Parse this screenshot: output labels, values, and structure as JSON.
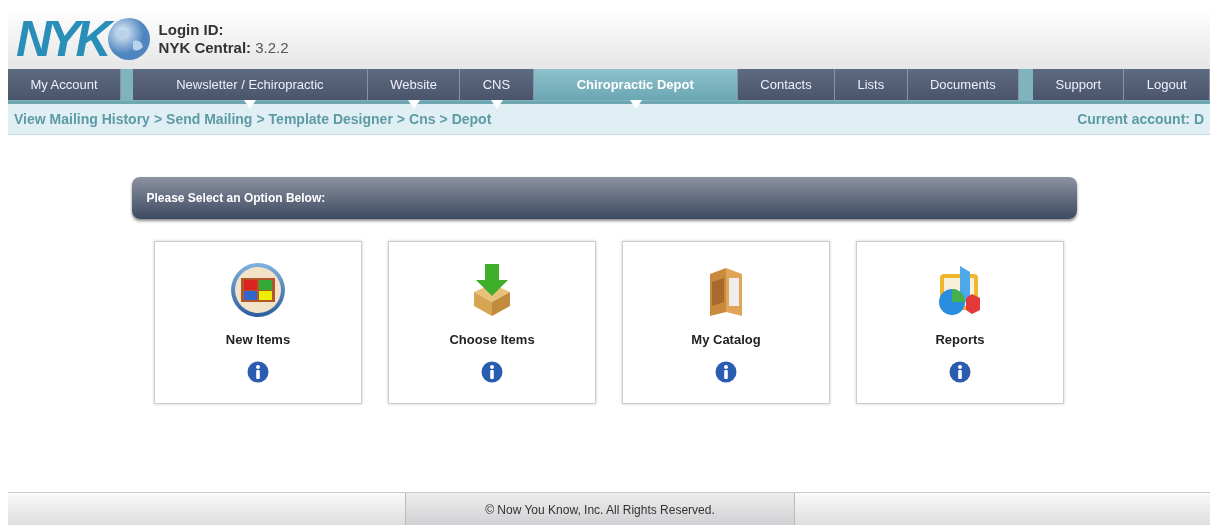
{
  "header": {
    "logo": "NYK",
    "login_label": "Login ID:",
    "version_label": "NYK Central:",
    "version": "3.2.2"
  },
  "nav": [
    {
      "label": "My Account",
      "selected": false,
      "has_menu": false
    },
    {
      "label": "Newsletter / Echiropractic",
      "selected": false,
      "has_menu": true
    },
    {
      "label": "Website",
      "selected": false,
      "has_menu": true
    },
    {
      "label": "CNS",
      "selected": false,
      "has_menu": true
    },
    {
      "label": "Chiropractic Depot",
      "selected": true,
      "has_menu": true
    },
    {
      "label": "Contacts",
      "selected": false,
      "has_menu": false
    },
    {
      "label": "Lists",
      "selected": false,
      "has_menu": false
    },
    {
      "label": "Documents",
      "selected": false,
      "has_menu": false
    },
    {
      "label": "Support",
      "selected": false,
      "has_menu": false
    },
    {
      "label": "Logout",
      "selected": false,
      "has_menu": false
    }
  ],
  "breadcrumb": [
    "View Mailing History",
    "Send Mailing",
    "Template Designer",
    "Cns",
    "Depot"
  ],
  "breadcrumb_separator": ">",
  "current_account": "Current account: D",
  "panel_title": "Please Select an Option Below:",
  "options": [
    {
      "label": "New Items",
      "kind": "new"
    },
    {
      "label": "Choose Items",
      "kind": "choose"
    },
    {
      "label": "My Catalog",
      "kind": "catalog"
    },
    {
      "label": "Reports",
      "kind": "reports"
    }
  ],
  "footer": "© Now You Know, Inc. All Rights Reserved."
}
